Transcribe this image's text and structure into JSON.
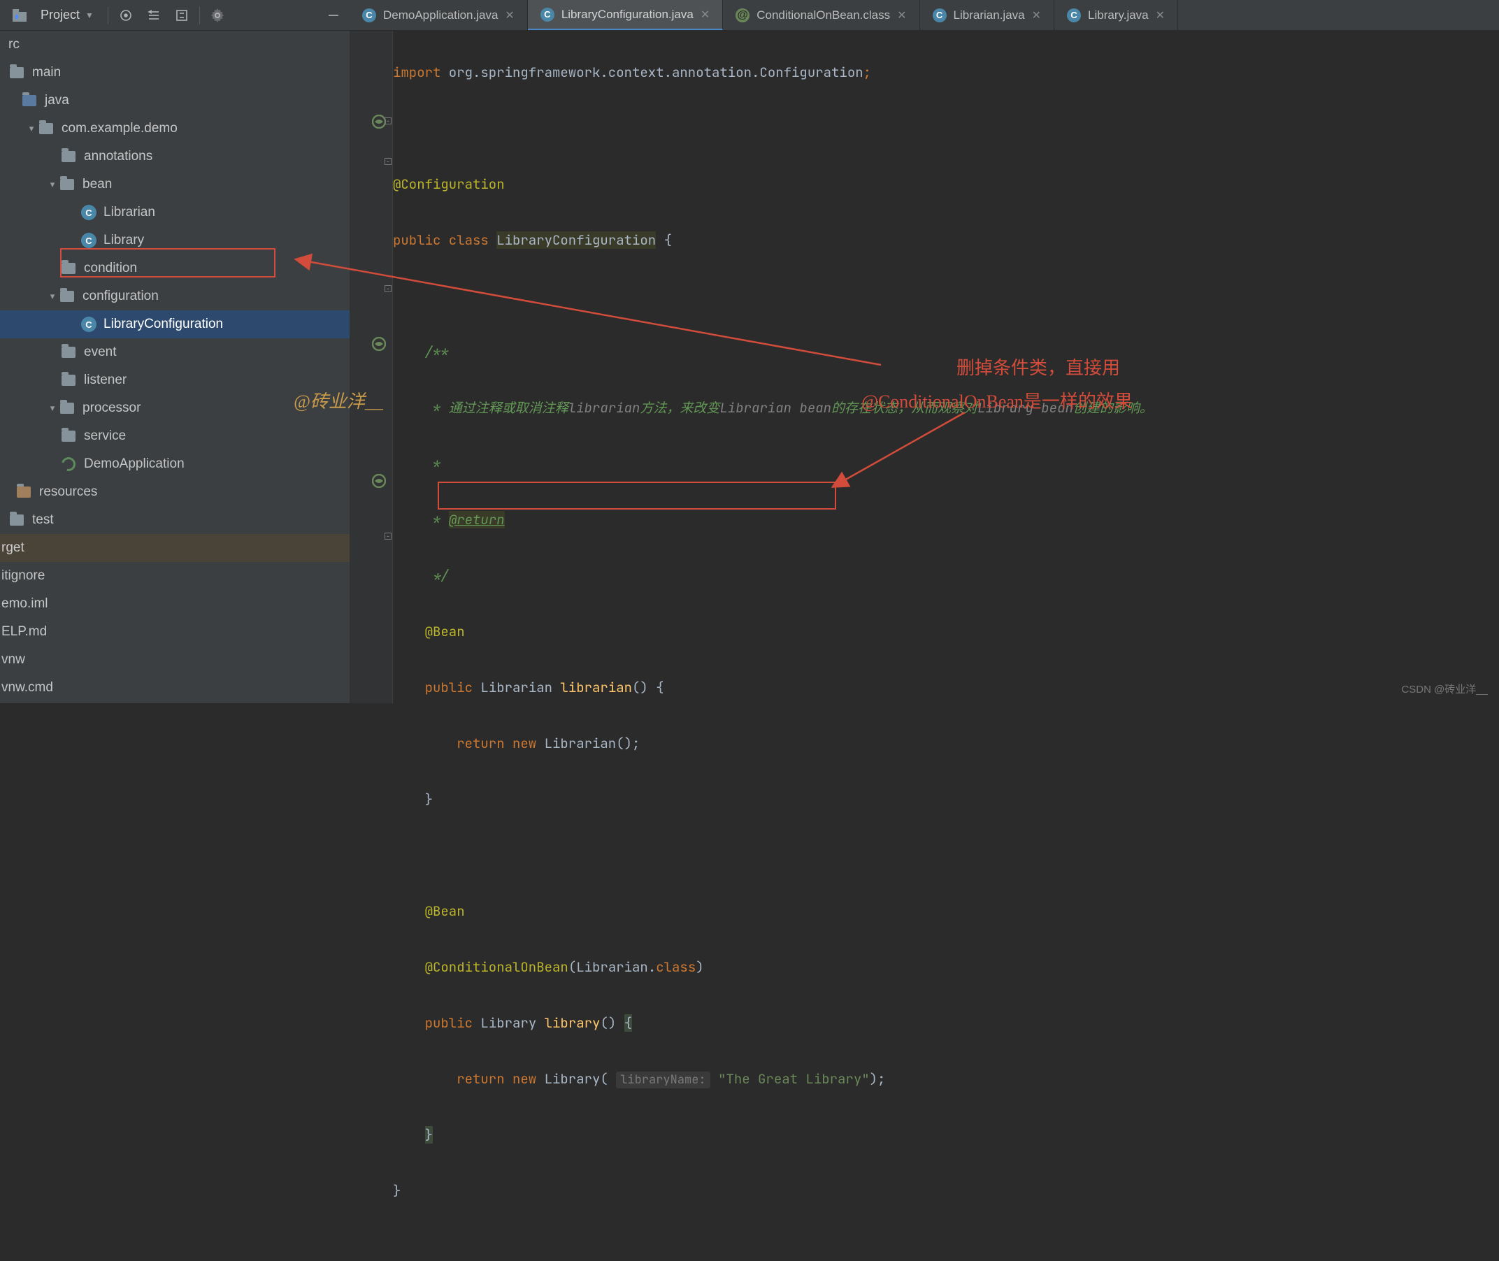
{
  "toolbar": {
    "project_label": "Project"
  },
  "tabs": [
    {
      "label": "DemoApplication.java",
      "icon": "c",
      "active": false
    },
    {
      "label": "LibraryConfiguration.java",
      "icon": "c",
      "active": true
    },
    {
      "label": "ConditionalOnBean.class",
      "icon": "at",
      "active": false
    },
    {
      "label": "Librarian.java",
      "icon": "c",
      "active": false
    },
    {
      "label": "Library.java",
      "icon": "c",
      "active": false
    }
  ],
  "tree": {
    "rc": "rc",
    "main": "main",
    "java": "java",
    "pkg": "com.example.demo",
    "annotations": "annotations",
    "bean": "bean",
    "librarian": "Librarian",
    "library": "Library",
    "condition": "condition",
    "configuration": "configuration",
    "libconfig": "LibraryConfiguration",
    "event": "event",
    "listener": "listener",
    "processor": "processor",
    "service": "service",
    "demoapp": "DemoApplication",
    "resources": "resources",
    "test": "test",
    "rget": "rget",
    "gitignore": "itignore",
    "emoiml": "emo.iml",
    "elpmd": "ELP.md",
    "vnw": "vnw",
    "vnwcmd": "vnw.cmd"
  },
  "code": {
    "l1a": "import",
    "l1b": " org.springframework.context.annotation.",
    "l1c": "Configuration",
    "l1d": ";",
    "l3": "@Configuration",
    "l4a": "public class ",
    "l4b": "LibraryConfiguration",
    "l4c": " {",
    "l6": "/**",
    "l7a": " * 通过注释或取消注释",
    "l7b": "librarian",
    "l7c": "方法，来改变",
    "l7d": "Librarian bean",
    "l7e": "的存在状态，从而观察对",
    "l7f": "Library bean",
    "l7g": "创建的影响。",
    "l8": " *",
    "l9a": " * ",
    "l9b": "@return",
    "l10": " */",
    "l11": "@Bean",
    "l12a": "public",
    "l12b": " Librarian ",
    "l12c": "librarian",
    "l12d": "() {",
    "l13a": "return new ",
    "l13b": "Librarian();",
    "l14": "}",
    "l16": "@Bean",
    "l17a": "@ConditionalOnBean",
    "l17b": "(Librarian.",
    "l17c": "class",
    "l17d": ")",
    "l18a": "public",
    "l18b": " Library ",
    "l18c": "library",
    "l18d": "() ",
    "l18e": "{",
    "l19a": "return new ",
    "l19b": "Library(",
    "l19c": "libraryName:",
    "l19d": " \"The Great Library\"",
    "l19e": ");",
    "l20": "}",
    "l21": "}"
  },
  "annotations": {
    "watermark": "@砖业洋__",
    "red1": "删掉条件类，直接用",
    "red2": "@ConditionalOnBean是一样的效果",
    "csdn": "CSDN @砖业洋__"
  }
}
